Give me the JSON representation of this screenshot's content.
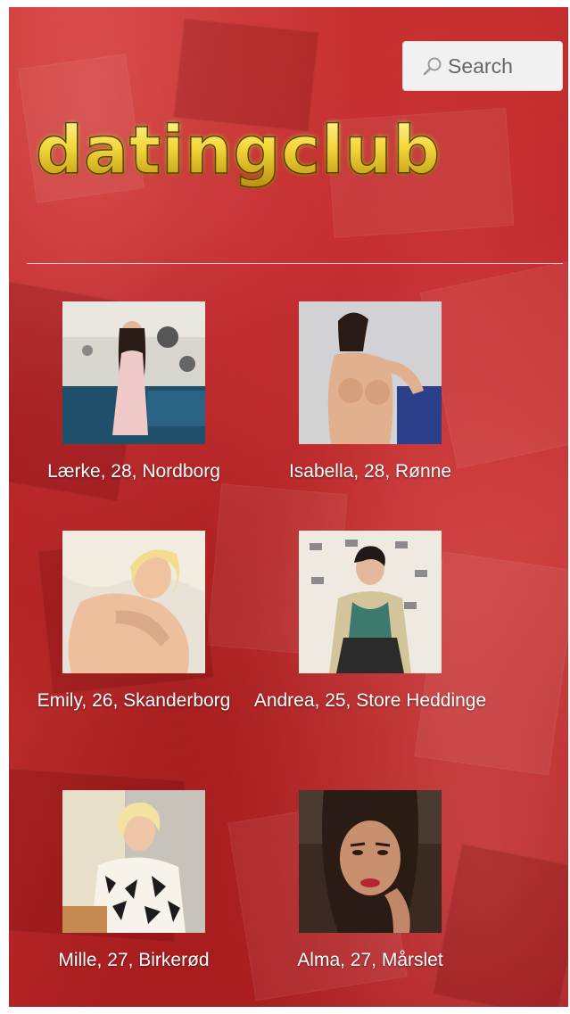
{
  "header": {
    "search_label": "Search",
    "logo_text": "datingclub"
  },
  "profiles": [
    {
      "caption": "Lærke, 28, Nordborg"
    },
    {
      "caption": "Isabella, 28, Rønne"
    },
    {
      "caption": "Emily, 26, Skanderborg"
    },
    {
      "caption": "Andrea, 25, Store Heddinge"
    },
    {
      "caption": "Mille, 27, Birkerød"
    },
    {
      "caption": "Alma, 27, Mårslet"
    }
  ],
  "colors": {
    "background_red": "#c22a2b",
    "logo_gold": "#f3d83a",
    "text_white": "#ffffff"
  }
}
